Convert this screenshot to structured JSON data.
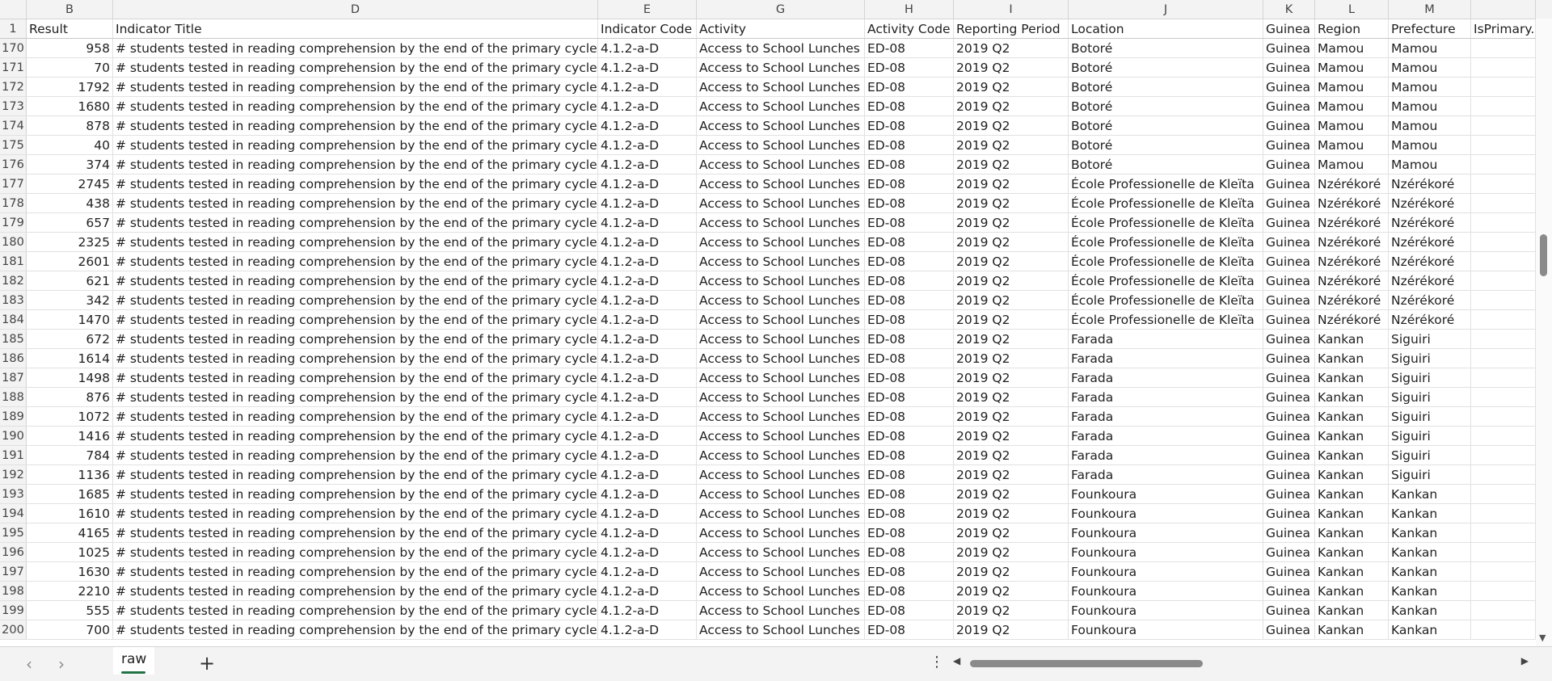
{
  "columns": [
    {
      "letter": "B"
    },
    {
      "letter": "D"
    },
    {
      "letter": "E"
    },
    {
      "letter": "G"
    },
    {
      "letter": "H"
    },
    {
      "letter": "I"
    },
    {
      "letter": "J"
    },
    {
      "letter": "K"
    },
    {
      "letter": "L"
    },
    {
      "letter": "M"
    },
    {
      "letter": ""
    }
  ],
  "header_row": {
    "number": "1",
    "cells": [
      "Result",
      "Indicator Title",
      "Indicator Code",
      "Activity",
      "Activity Code",
      "Reporting Period",
      "Location",
      "Guinea",
      "Region",
      "Prefecture",
      "IsPrimary..."
    ]
  },
  "rows": [
    {
      "n": "170",
      "result": "958",
      "location": "Botoré",
      "region": "Mamou",
      "prefecture": "Mamou"
    },
    {
      "n": "171",
      "result": "70",
      "location": "Botoré",
      "region": "Mamou",
      "prefecture": "Mamou"
    },
    {
      "n": "172",
      "result": "1792",
      "location": "Botoré",
      "region": "Mamou",
      "prefecture": "Mamou"
    },
    {
      "n": "173",
      "result": "1680",
      "location": "Botoré",
      "region": "Mamou",
      "prefecture": "Mamou"
    },
    {
      "n": "174",
      "result": "878",
      "location": "Botoré",
      "region": "Mamou",
      "prefecture": "Mamou"
    },
    {
      "n": "175",
      "result": "40",
      "location": "Botoré",
      "region": "Mamou",
      "prefecture": "Mamou"
    },
    {
      "n": "176",
      "result": "374",
      "location": "Botoré",
      "region": "Mamou",
      "prefecture": "Mamou"
    },
    {
      "n": "177",
      "result": "2745",
      "location": "École Professionelle de Kleïta",
      "region": "Nzérékoré",
      "prefecture": "Nzérékoré"
    },
    {
      "n": "178",
      "result": "438",
      "location": "École Professionelle de Kleïta",
      "region": "Nzérékoré",
      "prefecture": "Nzérékoré"
    },
    {
      "n": "179",
      "result": "657",
      "location": "École Professionelle de Kleïta",
      "region": "Nzérékoré",
      "prefecture": "Nzérékoré"
    },
    {
      "n": "180",
      "result": "2325",
      "location": "École Professionelle de Kleïta",
      "region": "Nzérékoré",
      "prefecture": "Nzérékoré"
    },
    {
      "n": "181",
      "result": "2601",
      "location": "École Professionelle de Kleïta",
      "region": "Nzérékoré",
      "prefecture": "Nzérékoré"
    },
    {
      "n": "182",
      "result": "621",
      "location": "École Professionelle de Kleïta",
      "region": "Nzérékoré",
      "prefecture": "Nzérékoré"
    },
    {
      "n": "183",
      "result": "342",
      "location": "École Professionelle de Kleïta",
      "region": "Nzérékoré",
      "prefecture": "Nzérékoré"
    },
    {
      "n": "184",
      "result": "1470",
      "location": "École Professionelle de Kleïta",
      "region": "Nzérékoré",
      "prefecture": "Nzérékoré"
    },
    {
      "n": "185",
      "result": "672",
      "location": "Farada",
      "region": "Kankan",
      "prefecture": "Siguiri"
    },
    {
      "n": "186",
      "result": "1614",
      "location": "Farada",
      "region": "Kankan",
      "prefecture": "Siguiri"
    },
    {
      "n": "187",
      "result": "1498",
      "location": "Farada",
      "region": "Kankan",
      "prefecture": "Siguiri"
    },
    {
      "n": "188",
      "result": "876",
      "location": "Farada",
      "region": "Kankan",
      "prefecture": "Siguiri"
    },
    {
      "n": "189",
      "result": "1072",
      "location": "Farada",
      "region": "Kankan",
      "prefecture": "Siguiri"
    },
    {
      "n": "190",
      "result": "1416",
      "location": "Farada",
      "region": "Kankan",
      "prefecture": "Siguiri"
    },
    {
      "n": "191",
      "result": "784",
      "location": "Farada",
      "region": "Kankan",
      "prefecture": "Siguiri"
    },
    {
      "n": "192",
      "result": "1136",
      "location": "Farada",
      "region": "Kankan",
      "prefecture": "Siguiri"
    },
    {
      "n": "193",
      "result": "1685",
      "location": "Founkoura",
      "region": "Kankan",
      "prefecture": "Kankan"
    },
    {
      "n": "194",
      "result": "1610",
      "location": "Founkoura",
      "region": "Kankan",
      "prefecture": "Kankan"
    },
    {
      "n": "195",
      "result": "4165",
      "location": "Founkoura",
      "region": "Kankan",
      "prefecture": "Kankan"
    },
    {
      "n": "196",
      "result": "1025",
      "location": "Founkoura",
      "region": "Kankan",
      "prefecture": "Kankan"
    },
    {
      "n": "197",
      "result": "1630",
      "location": "Founkoura",
      "region": "Kankan",
      "prefecture": "Kankan"
    },
    {
      "n": "198",
      "result": "2210",
      "location": "Founkoura",
      "region": "Kankan",
      "prefecture": "Kankan"
    },
    {
      "n": "199",
      "result": "555",
      "location": "Founkoura",
      "region": "Kankan",
      "prefecture": "Kankan"
    },
    {
      "n": "200",
      "result": "700",
      "location": "Founkoura",
      "region": "Kankan",
      "prefecture": "Kankan"
    }
  ],
  "common": {
    "indicator_title": "# students tested in reading comprehension by the end of the primary cycle",
    "indicator_code": "4.1.2-a-D",
    "activity": "Access to School Lunches",
    "activity_code": "ED-08",
    "reporting_period": "2019 Q2",
    "country": "Guinea"
  },
  "bottom": {
    "prev_sheet": "‹",
    "next_sheet": "›",
    "active_tab": "raw",
    "add_sheet": "+",
    "more": "⋮",
    "scroll_left": "◀",
    "scroll_right": "▶",
    "scroll_down": "▼"
  },
  "colors": {
    "accent": "#217346",
    "header_bg": "#f3f3f3",
    "gridline": "#e1e1e1"
  }
}
